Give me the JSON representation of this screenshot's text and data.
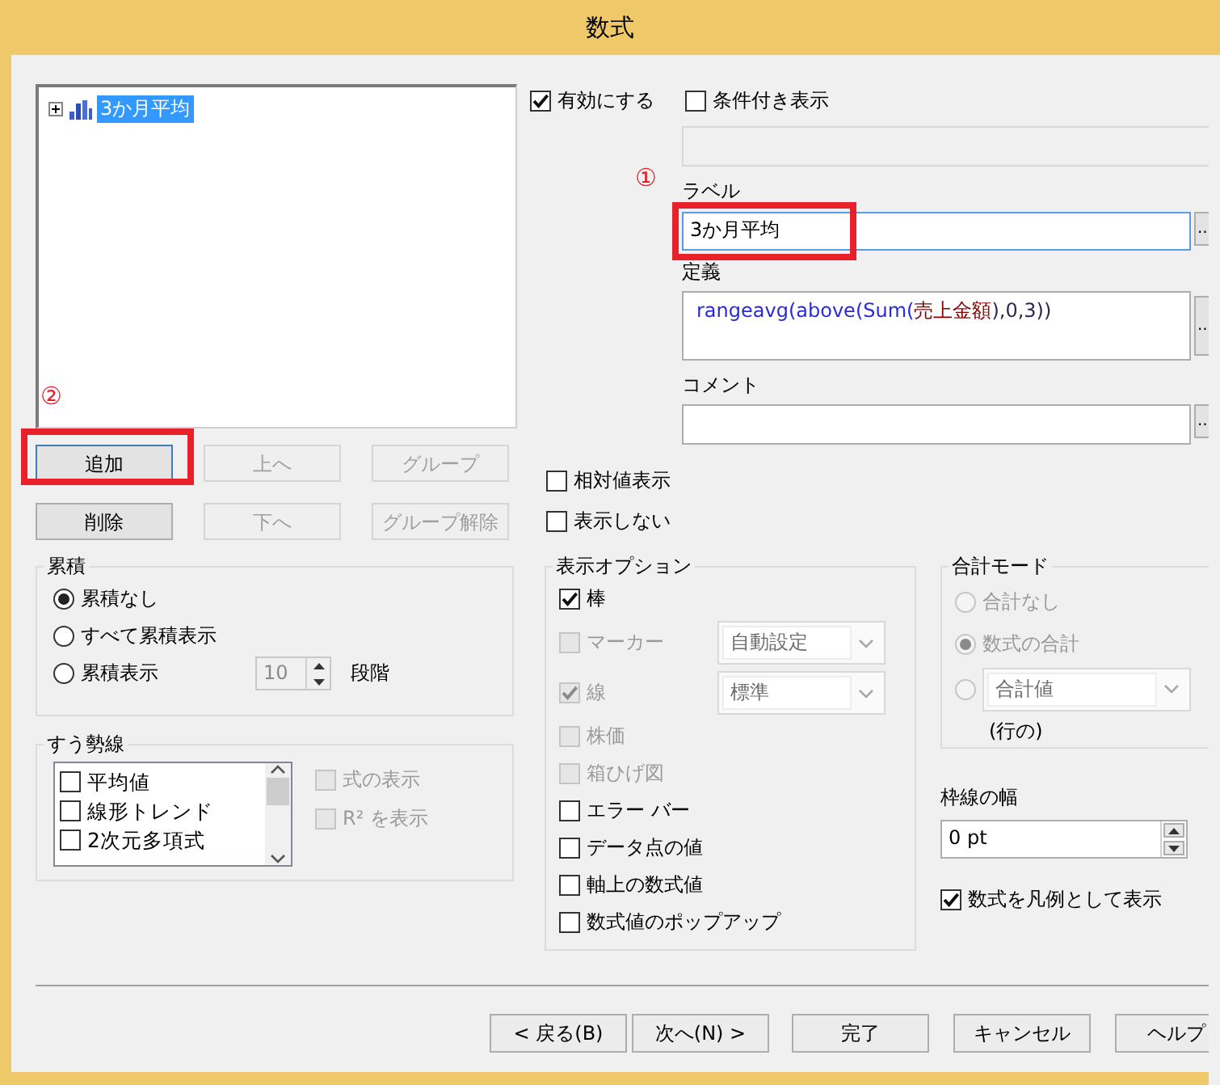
{
  "window": {
    "title": "数式"
  },
  "formula_tree": {
    "items": [
      {
        "label": "3か月平均",
        "selected": true,
        "expanded": false
      }
    ],
    "marker": "②"
  },
  "list_buttons": [
    {
      "label": "追加",
      "disabled": false,
      "highlighted": true
    },
    {
      "label": "上へ",
      "disabled": true,
      "highlighted": false
    },
    {
      "label": "グループ",
      "disabled": true,
      "highlighted": false
    },
    {
      "label": "削除",
      "disabled": false,
      "highlighted": false
    },
    {
      "label": "下へ",
      "disabled": true,
      "highlighted": false
    },
    {
      "label": "グループ解除",
      "disabled": true,
      "highlighted": false
    }
  ],
  "enable": {
    "label": "有効にする",
    "checked": true
  },
  "conditional": {
    "label": "条件付き表示",
    "checked": false
  },
  "condition_field": {
    "disabled": true
  },
  "label_field": {
    "marker": "①",
    "label": "ラベル",
    "value": "3か月平均",
    "highlighted": true,
    "browse_button": "..."
  },
  "definition_field": {
    "label": "定義",
    "parts": [
      {
        "kind": "function",
        "text": "rangeavg(above(Sum("
      },
      {
        "kind": "field",
        "text": "売上金額"
      },
      {
        "kind": "plain",
        "text": "),0,3))"
      }
    ],
    "browse_button": "..."
  },
  "comment_field": {
    "label": "コメント",
    "browse_button": "..."
  },
  "relative": {
    "label": "相対値表示",
    "checked": false
  },
  "hide": {
    "label": "表示しない",
    "checked": false
  },
  "accumulation": {
    "title": "累積",
    "options": [
      {
        "label": "累積なし",
        "selected": true
      },
      {
        "label": "すべて累積表示",
        "selected": false
      },
      {
        "label": "累積表示",
        "selected": false
      }
    ],
    "steps": {
      "value": "10",
      "disabled": true
    },
    "unit": "段階"
  },
  "trendlines": {
    "title": "すう勢線",
    "items": [
      {
        "label": "平均値",
        "checked": false
      },
      {
        "label": "線形トレンド",
        "checked": false
      },
      {
        "label": "2次元多項式",
        "checked": false
      }
    ],
    "options": [
      {
        "label": "式の表示",
        "checked": false,
        "disabled": true
      },
      {
        "label": "R² を表示",
        "checked": false,
        "disabled": true
      }
    ]
  },
  "display_options": {
    "title": "表示オプション",
    "items": [
      {
        "kind": "checkbox",
        "label": "棒",
        "checked": true,
        "disabled": false
      },
      {
        "kind": "dropdown",
        "label": "マーカー",
        "checked": false,
        "disabled": true,
        "value": "自動設定"
      },
      {
        "kind": "dropdown",
        "label": "線",
        "checked": true,
        "disabled": true,
        "value": "標準"
      },
      {
        "kind": "checkbox",
        "label": "株価",
        "checked": false,
        "disabled": true
      },
      {
        "kind": "checkbox",
        "label": "箱ひげ図",
        "checked": false,
        "disabled": true
      },
      {
        "kind": "checkbox",
        "label": "エラー バー",
        "checked": false,
        "disabled": false
      },
      {
        "kind": "checkbox",
        "label": "データ点の値",
        "checked": false,
        "disabled": false
      },
      {
        "kind": "checkbox",
        "label": "軸上の数式値",
        "checked": false,
        "disabled": false
      },
      {
        "kind": "checkbox",
        "label": "数式値のポップアップ",
        "checked": false,
        "disabled": false
      }
    ]
  },
  "total_mode": {
    "title": "合計モード",
    "disabled": true,
    "options": [
      {
        "kind": "radio",
        "label": "合計なし",
        "selected": false
      },
      {
        "kind": "radio",
        "label": "数式の合計",
        "selected": true
      },
      {
        "kind": "dropdown",
        "value": "合計値",
        "selected": false
      }
    ],
    "note": "(行の)"
  },
  "border_width": {
    "label": "枠線の幅",
    "value": "0 pt"
  },
  "legend": {
    "label": "数式を凡例として表示",
    "checked": true
  },
  "footer_buttons": [
    {
      "label": "< 戻る(B)"
    },
    {
      "label": "次へ(N) >"
    },
    {
      "label": "完了"
    },
    {
      "label": "キャンセル"
    },
    {
      "label": "ヘルプ"
    }
  ]
}
